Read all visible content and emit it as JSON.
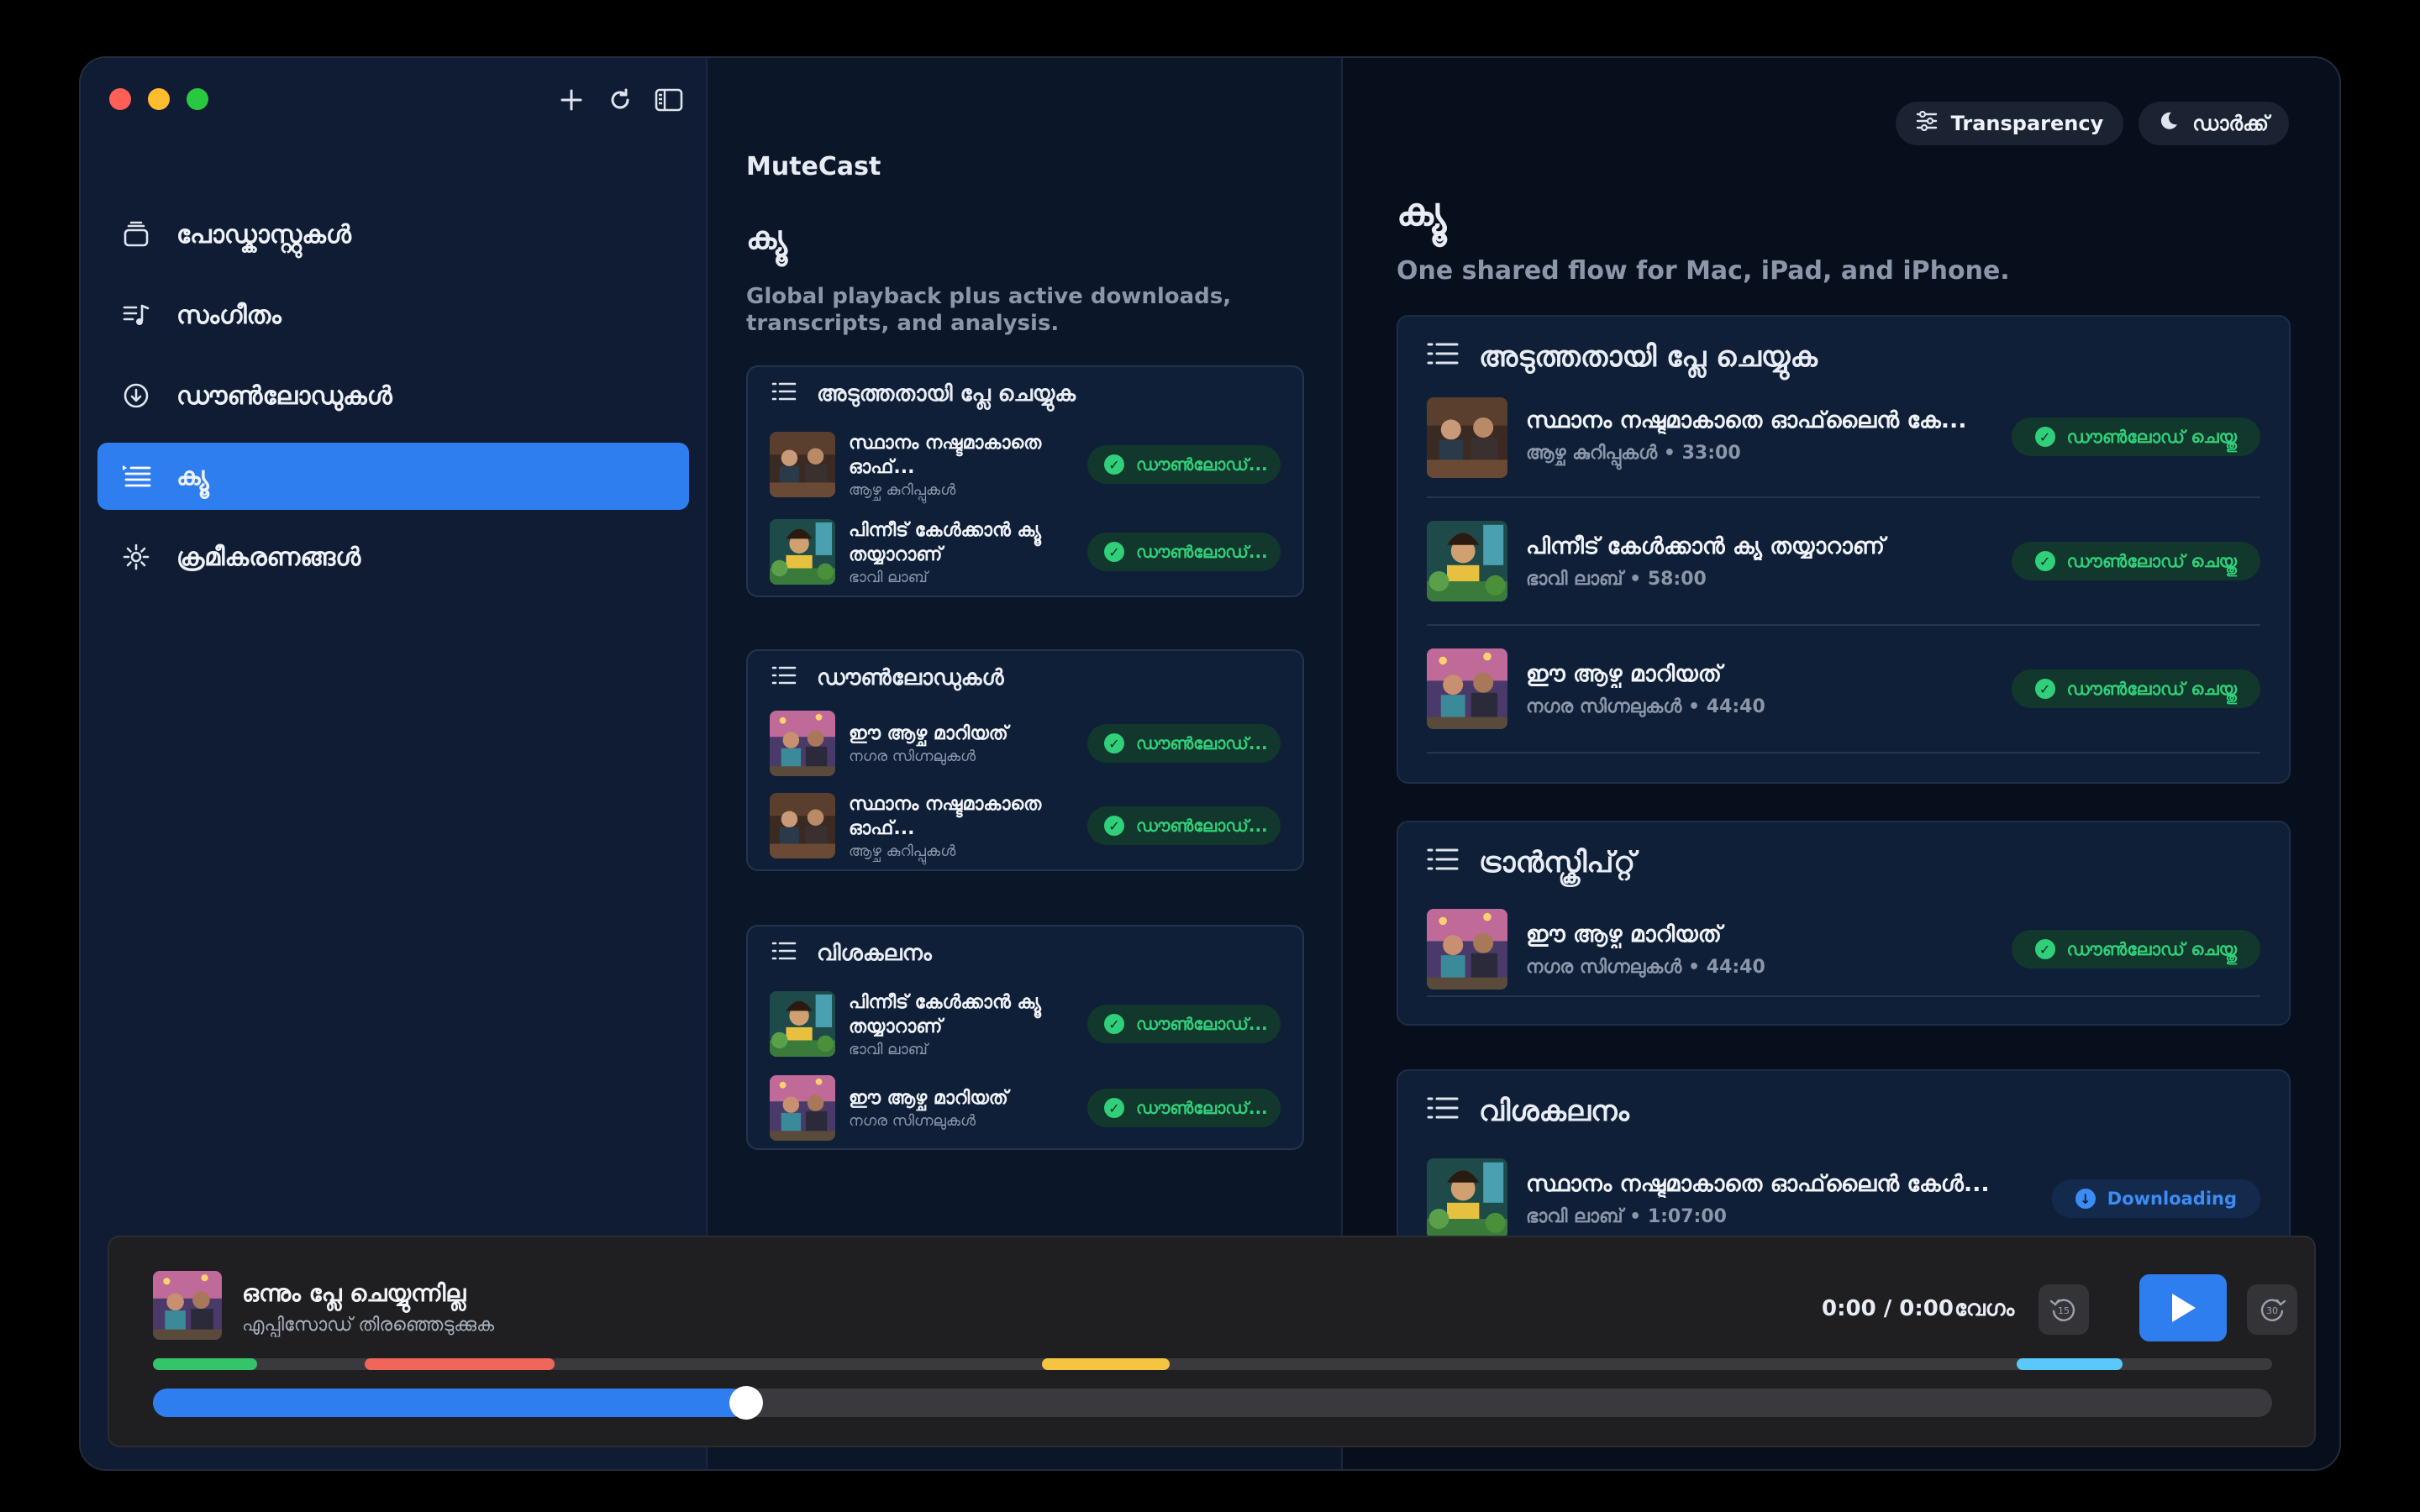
{
  "sidebar": {
    "items": [
      {
        "label": "പോഡ്കാസ്റ്റുകൾ",
        "icon": "podcast-stack-icon"
      },
      {
        "label": "സംഗീതം",
        "icon": "music-list-icon"
      },
      {
        "label": "ഡൗൺലോഡുകൾ",
        "icon": "download-circle-icon"
      },
      {
        "label": "ക്യൂ",
        "icon": "queue-list-icon",
        "active": true
      },
      {
        "label": "ക്രമീകരണങ്ങൾ",
        "icon": "gear-icon"
      }
    ]
  },
  "middle": {
    "app_name": "MuteCast",
    "title": "ക്യൂ",
    "subtitle": "Global playback plus active downloads, transcripts, and analysis.",
    "sections": [
      {
        "heading": "അടുത്തതായി പ്ലേ ചെയ്യുക",
        "rows": [
          {
            "title": "സ്ഥാനം നഷ്ടമാകാതെ ഓഫ്...",
            "show": "ആഴ്ച കുറിപ്പുകൾ",
            "status": "ഡൗൺലോഡ്..."
          },
          {
            "title": "പിന്നീട് കേൾക്കാൻ ക്യൂ തയ്യാറാണ്",
            "show": "ഭാവി ലാബ്",
            "status": "ഡൗൺലോഡ്..."
          }
        ]
      },
      {
        "heading": "ഡൗൺലോഡുകൾ",
        "rows": [
          {
            "title": "ഈ ആഴ്ച മാറിയത്",
            "show": "നഗര സിഗ്നലുകൾ",
            "status": "ഡൗൺലോഡ്..."
          },
          {
            "title": "സ്ഥാനം നഷ്ടമാകാതെ ഓഫ്...",
            "show": "ആഴ്ച കുറിപ്പുകൾ",
            "status": "ഡൗൺലോഡ്..."
          }
        ]
      },
      {
        "heading": "വിശകലനം",
        "rows": [
          {
            "title": "പിന്നീട് കേൾക്കാൻ ക്യൂ തയ്യാറാണ്",
            "show": "ഭാവി ലാബ്",
            "status": "ഡൗൺലോഡ്..."
          },
          {
            "title": "ഈ ആഴ്ച മാറിയത്",
            "show": "നഗര സിഗ്നലുകൾ",
            "status": "ഡൗൺലോഡ്..."
          }
        ]
      }
    ]
  },
  "right": {
    "buttons": {
      "transparency": "Transparency",
      "theme": "ഡാർക്ക്"
    },
    "title": "ക്യൂ",
    "subtitle": "One shared flow for Mac, iPad, and iPhone.",
    "sections": [
      {
        "heading": "അടുത്തതായി പ്ലേ ചെയ്യുക",
        "rows": [
          {
            "title": "സ്ഥാനം നഷ്ടമാകാതെ ഓഫ്‌ലൈൻ കേ...",
            "meta": "ആഴ്ച കുറിപ്പുകൾ • 33:00",
            "status": "ഡൗൺലോഡ് ചെയ്തു"
          },
          {
            "title": "പിന്നീട് കേൾക്കാൻ ക്യൂ തയ്യാറാണ്",
            "meta": "ഭാവി ലാബ് • 58:00",
            "status": "ഡൗൺലോഡ് ചെയ്തു"
          },
          {
            "title": "ഈ ആഴ്ച മാറിയത്",
            "meta": "നഗര സിഗ്നലുകൾ • 44:40",
            "status": "ഡൗൺലോഡ് ചെയ്തു"
          }
        ]
      },
      {
        "heading": "ട്രാൻസ്ക്രിപ്റ്റ്",
        "rows": [
          {
            "title": "ഈ ആഴ്ച മാറിയത്",
            "meta": "നഗര സിഗ്നലുകൾ • 44:40",
            "status": "ഡൗൺലോഡ് ചെയ്തു"
          }
        ]
      },
      {
        "heading": "വിശകലനം",
        "rows": [
          {
            "title": "സ്ഥാനം നഷ്ടമാകാതെ ഓഫ്‌ലൈൻ കേൾ...",
            "meta": "ഭാവി ലാബ് • 1:07:00",
            "status": "Downloading"
          }
        ]
      }
    ]
  },
  "player": {
    "title": "ഒന്നും പ്ലേ ചെയ്യുന്നില്ല",
    "subtitle": "എപ്പിസോഡ് തിരഞ്ഞെടുക്കുക",
    "time": "0:00 / 0:00",
    "speed_label": "വേഗം",
    "skip_back": "15",
    "skip_forward": "30",
    "progress": 0.28,
    "colors": {
      "accent": "#2f7ef0",
      "success": "#30d07a",
      "chapter_green": "#34c46a",
      "chapter_red": "#f0665a",
      "chapter_yellow": "#f5c542",
      "chapter_cyan": "#5ac8fa"
    }
  }
}
